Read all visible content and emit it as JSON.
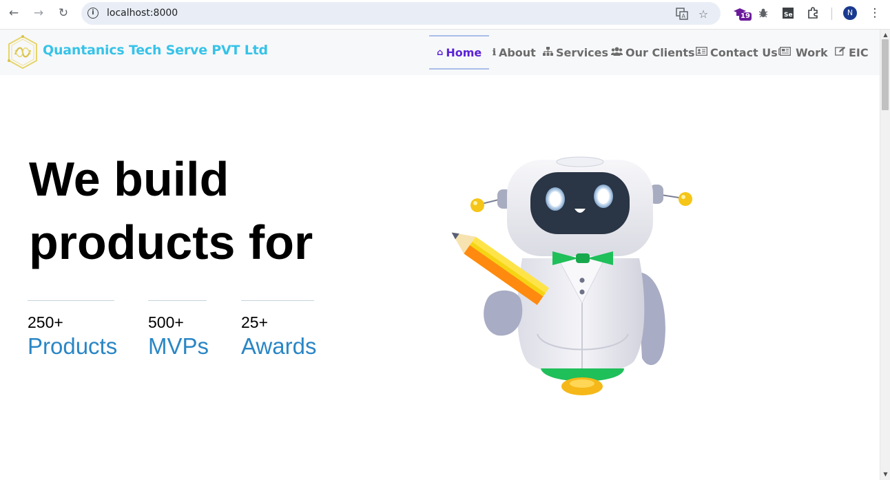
{
  "browser": {
    "url": "localhost:8000",
    "profile_initial": "N",
    "extension_badge": "19"
  },
  "site": {
    "brand": "Quantanics Tech Serve PVT Ltd",
    "nav": [
      {
        "label": "Home",
        "icon": "home-icon"
      },
      {
        "label": "About",
        "icon": "info-icon"
      },
      {
        "label": "Services",
        "icon": "sitemap-icon"
      },
      {
        "label": "Our Clients",
        "icon": "users-icon"
      },
      {
        "label": "Contact Us",
        "icon": "address-card-icon"
      },
      {
        "label": "Work",
        "icon": "newspaper-icon"
      },
      {
        "label": "EIC",
        "icon": "edit-icon"
      }
    ],
    "active_nav": "Home"
  },
  "hero": {
    "title_line1": "We build",
    "title_line2": "products for",
    "stats": [
      {
        "number": "250+",
        "label": "Products"
      },
      {
        "number": "500+",
        "label": "MVPs"
      },
      {
        "number": "25+",
        "label": "Awards"
      }
    ]
  },
  "colors": {
    "brand": "#36c3e8",
    "active_nav": "#5a22d6",
    "stat_label": "#2a86c5",
    "nav_text": "#6b6b6b"
  }
}
